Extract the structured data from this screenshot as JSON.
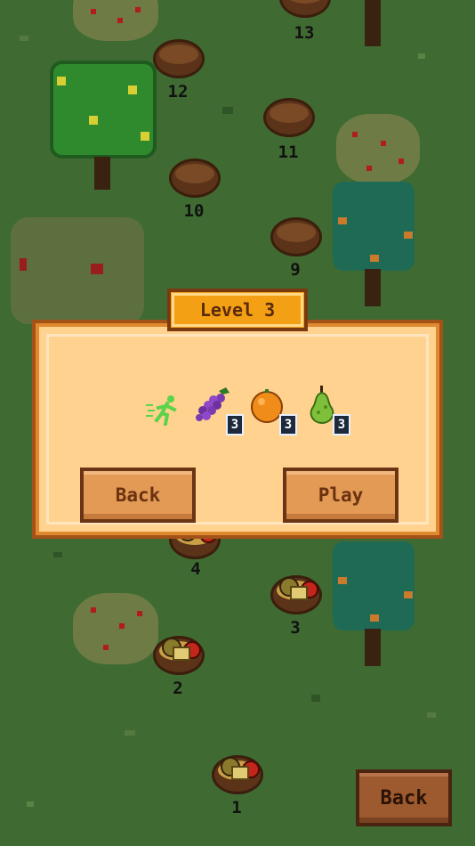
{
  "map": {
    "level_nodes": [
      {
        "number": "13"
      },
      {
        "number": "12"
      },
      {
        "number": "11"
      },
      {
        "number": "10"
      },
      {
        "number": "9"
      },
      {
        "number": "4"
      },
      {
        "number": "3"
      },
      {
        "number": "2"
      },
      {
        "number": "1"
      }
    ]
  },
  "dialog": {
    "title": "Level 3",
    "goals": [
      {
        "icon": "runner-icon"
      },
      {
        "icon": "grapes-icon",
        "count": "3"
      },
      {
        "icon": "orange-icon",
        "count": "3"
      },
      {
        "icon": "pear-icon",
        "count": "3"
      }
    ],
    "back_label": "Back",
    "play_label": "Play"
  },
  "footer": {
    "back_label": "Back"
  },
  "colors": {
    "grass": "#3f6b32",
    "panel": "#ffd28f",
    "title_badge": "#f3a014",
    "button": "#e39a55"
  }
}
